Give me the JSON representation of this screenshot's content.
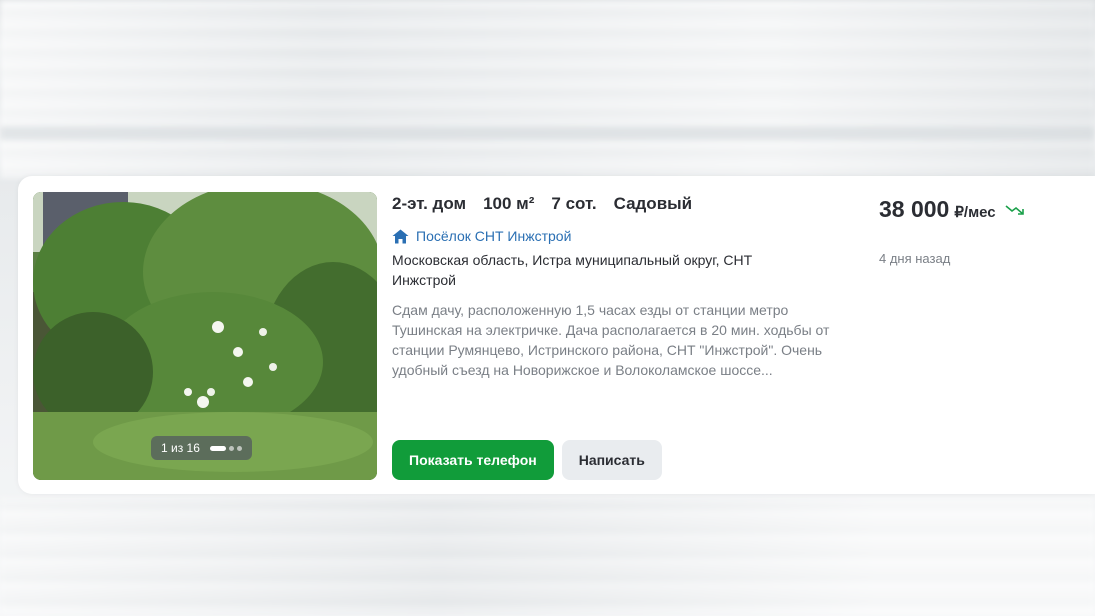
{
  "listing": {
    "params": [
      "2-эт. дом",
      "100 м²",
      "7 сот.",
      "Садовый"
    ],
    "locality": "Посёлок СНТ Инжстрой",
    "address": "Московская область, Истра муниципальный округ, СНТ Инжстрой",
    "description": "Сдам дачу, расположенную 1,5 часах езды от станции метро Тушинская на электричке. Дача располагается в 20 мин. ходьбы от станции Румянцево, Истринского района, СНТ \"Инжстрой\". Очень удобный съезд на Новорижское и Волоколамское шоссе...",
    "photo_counter": "1 из 16",
    "price": "38 000",
    "price_unit": "₽/мес",
    "posted": "4 дня назад",
    "buttons": {
      "show_phone": "Показать телефон",
      "write": "Написать"
    }
  },
  "icons": {
    "locality": "house-icon",
    "price_trend": "trend-down-icon"
  },
  "colors": {
    "accent_green": "#119c3a",
    "link_blue": "#2a6fb3",
    "text_dark": "#2b2d33",
    "text_muted": "#7a7f86"
  }
}
